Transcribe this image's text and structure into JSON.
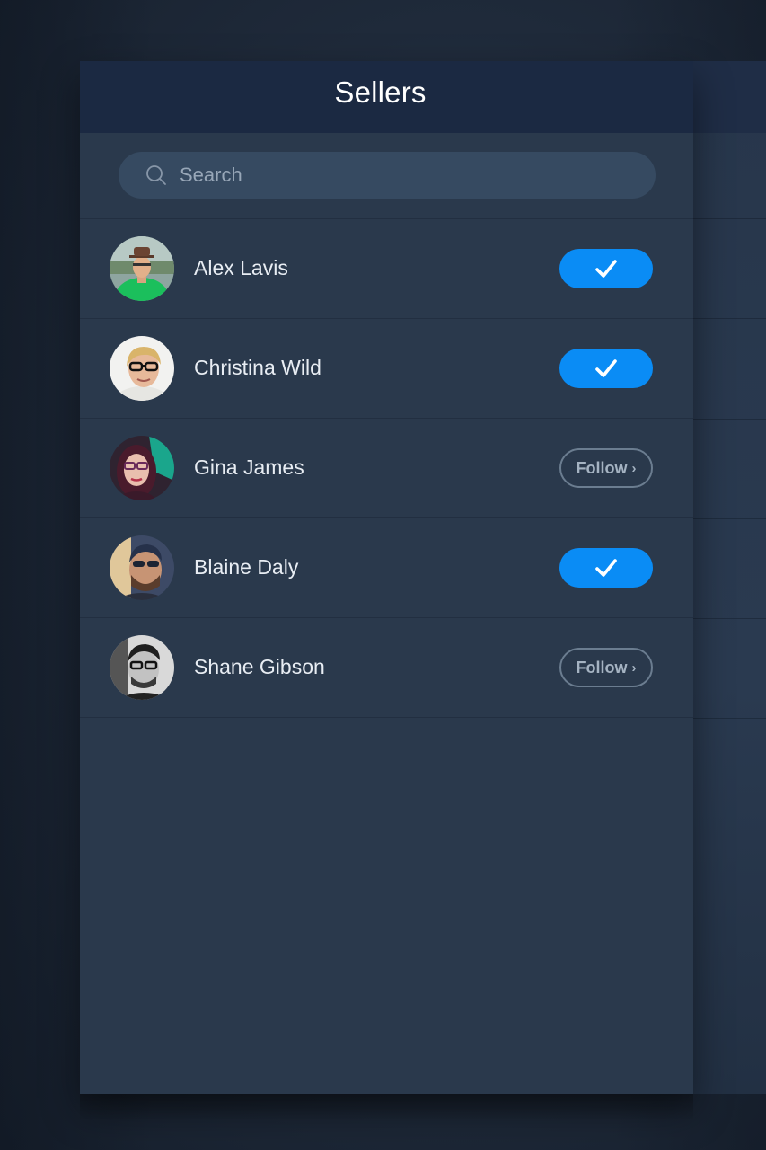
{
  "header": {
    "title": "Sellers"
  },
  "search": {
    "placeholder": "Search"
  },
  "sellers": [
    {
      "name": "Alex Lavis",
      "following": true
    },
    {
      "name": "Christina Wild",
      "following": true
    },
    {
      "name": "Gina James",
      "following": false,
      "follow_label": "Follow"
    },
    {
      "name": "Blaine Daly",
      "following": true
    },
    {
      "name": "Shane Gibson",
      "following": false,
      "follow_label": "Follow"
    }
  ],
  "colors": {
    "accent": "#0a8cf5",
    "header_bg": "#1b2942",
    "panel_bg": "#2a394c",
    "search_bg": "#364a61"
  },
  "icons": {
    "search": "search-icon",
    "check": "checkmark-icon",
    "chevron": "chevron-right-icon"
  }
}
